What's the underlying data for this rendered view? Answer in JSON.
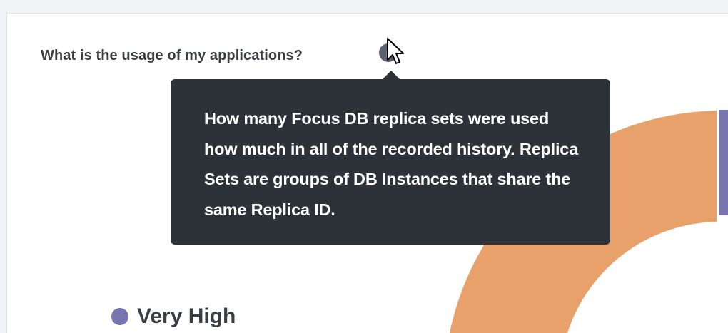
{
  "question": {
    "title": "What is the usage of my applications?",
    "info_icon": "info-icon"
  },
  "tooltip": {
    "text": "How many Focus DB replica sets were used how much in all of the recorded history. Replica Sets are groups of DB Instances that share the same Replica ID."
  },
  "legend": {
    "items": [
      {
        "label": "Very High",
        "color": "#7874b0"
      }
    ]
  },
  "colors": {
    "donut_orange": "#e8a16b",
    "donut_purple": "#7874b0",
    "tooltip_bg": "#2d3138",
    "text_dark": "#3a3d44",
    "info_icon": "#5a6170"
  },
  "cursor": "arrow-pointer-icon"
}
